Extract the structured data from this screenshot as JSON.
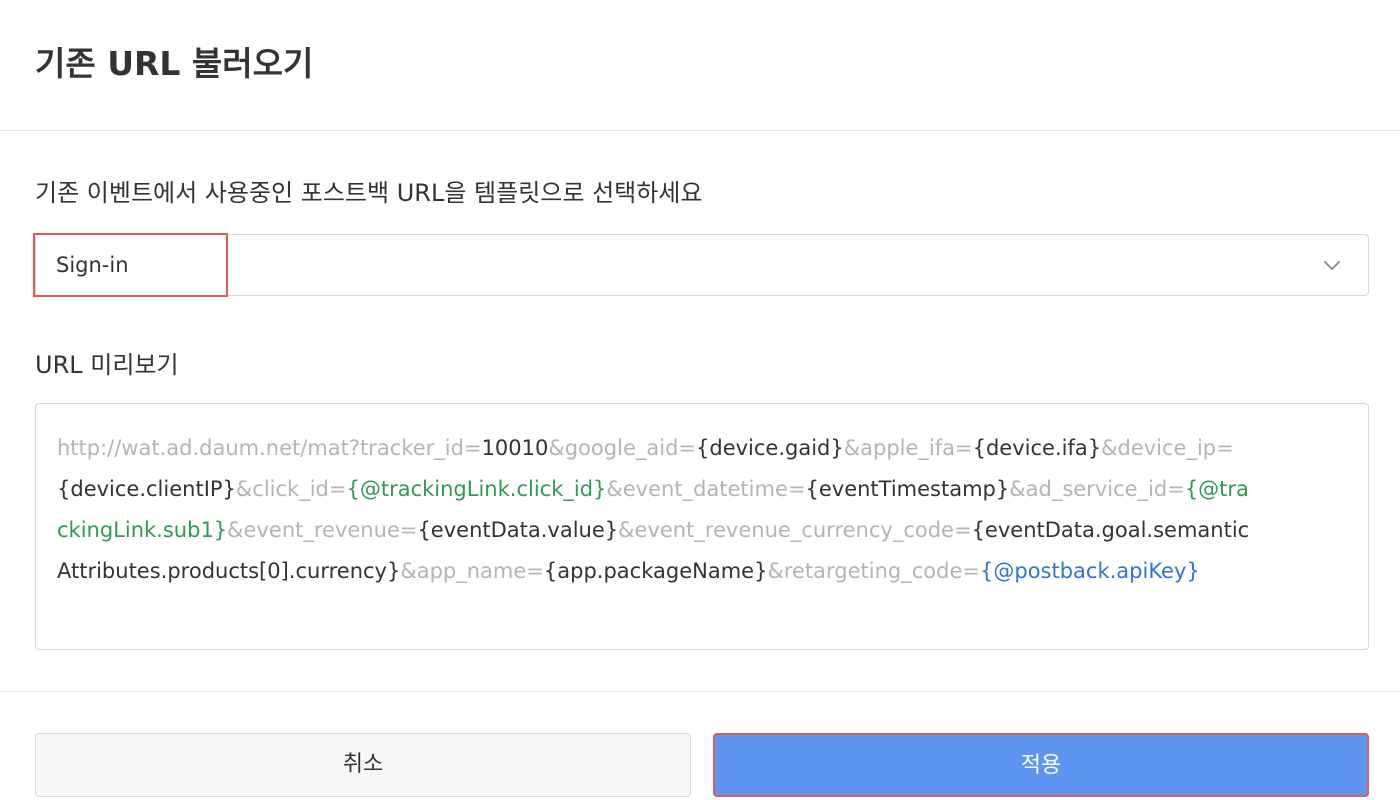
{
  "dialog": {
    "title": "기존 URL 불러오기"
  },
  "template_section": {
    "label": "기존 이벤트에서 사용중인 포스트백 URL을 템플릿으로 선택하세요",
    "selected_value": "Sign-in",
    "chevron_icon": "chevron-down-icon"
  },
  "preview_section": {
    "label": "URL 미리보기",
    "segments": [
      {
        "text": "http://wat.ad.daum.net/mat?tracker_id=",
        "kind": "static"
      },
      {
        "text": "10010",
        "kind": "var"
      },
      {
        "text": "&google_aid=",
        "kind": "static"
      },
      {
        "text": "{device.gaid}",
        "kind": "var"
      },
      {
        "text": "&apple_ifa=",
        "kind": "static"
      },
      {
        "text": "{device.ifa}",
        "kind": "var"
      },
      {
        "text": "&device_ip=",
        "kind": "static"
      },
      {
        "text": "{device.clientIP}",
        "kind": "var"
      },
      {
        "text": "&click_id=",
        "kind": "static"
      },
      {
        "text": "{@trackingLink.click_id}",
        "kind": "tracking"
      },
      {
        "text": "&event_datetime=",
        "kind": "static"
      },
      {
        "text": "{eventTimestamp}",
        "kind": "var"
      },
      {
        "text": "&ad_service_id=",
        "kind": "static"
      },
      {
        "text": "{@trackingLink.sub1}",
        "kind": "tracking"
      },
      {
        "text": "&event_revenue=",
        "kind": "static"
      },
      {
        "text": "{eventData.value}",
        "kind": "var"
      },
      {
        "text": "&event_revenue_currency_code=",
        "kind": "static"
      },
      {
        "text": "{eventData.goal.semanticAttributes.products[0].currency}",
        "kind": "var"
      },
      {
        "text": "&app_name=",
        "kind": "static"
      },
      {
        "text": "{app.packageName}",
        "kind": "var"
      },
      {
        "text": "&retargeting_code=",
        "kind": "static"
      },
      {
        "text": "{@postback.apiKey}",
        "kind": "postback"
      }
    ],
    "colors": {
      "static": "#b4b4b4",
      "var": "#333333",
      "tracking": "#2e9b55",
      "postback": "#2f74d6"
    }
  },
  "footer": {
    "cancel_label": "취소",
    "apply_label": "적용"
  },
  "colors": {
    "primary_button": "#5f95f2",
    "highlight_border": "#e05a5a"
  }
}
